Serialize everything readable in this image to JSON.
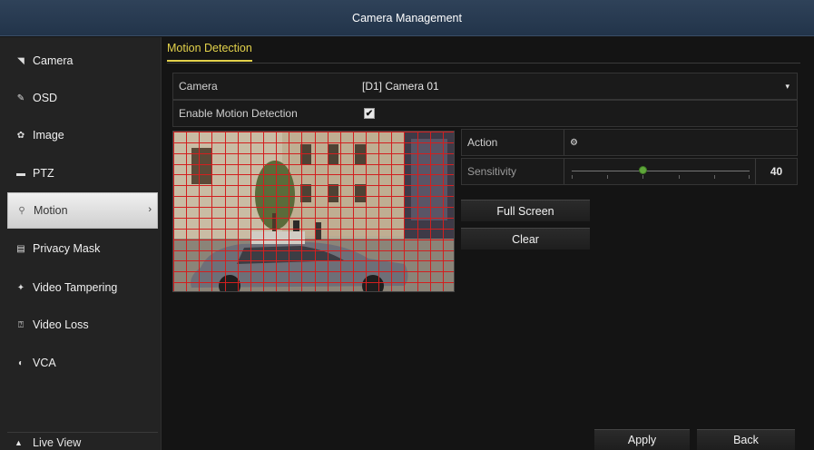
{
  "window": {
    "title": "Camera Management"
  },
  "sidebar": {
    "items": [
      {
        "label": "Camera",
        "icon": "camera-icon",
        "glyph": "◥"
      },
      {
        "label": "OSD",
        "icon": "osd-icon",
        "glyph": "✎"
      },
      {
        "label": "Image",
        "icon": "image-icon",
        "glyph": "✿"
      },
      {
        "label": "PTZ",
        "icon": "ptz-icon",
        "glyph": "▬"
      },
      {
        "label": "Motion",
        "icon": "motion-icon",
        "glyph": "⚲"
      },
      {
        "label": "Privacy Mask",
        "icon": "privacy-mask-icon",
        "glyph": "▤"
      },
      {
        "label": "Video Tampering",
        "icon": "video-tampering-icon",
        "glyph": "✦"
      },
      {
        "label": "Video Loss",
        "icon": "video-loss-icon",
        "glyph": "⍰"
      },
      {
        "label": "VCA",
        "icon": "vca-icon",
        "glyph": "◐"
      }
    ],
    "active": "Motion",
    "chevron": "›",
    "live_view": {
      "label": "Live View",
      "glyph": "▲"
    }
  },
  "main": {
    "tab": "Motion Detection",
    "camera_field": {
      "label": "Camera",
      "value": "[D1] Camera 01",
      "dropdown_glyph": "▾"
    },
    "enable_field": {
      "label": "Enable Motion Detection",
      "checked": true,
      "check_glyph": "✔"
    },
    "action": {
      "label": "Action",
      "glyph": "⚙"
    },
    "sensitivity": {
      "label": "Sensitivity",
      "value": "40",
      "level": 0.4
    },
    "buttons": {
      "full_screen": "Full Screen",
      "clear": "Clear"
    }
  },
  "footer": {
    "apply": "Apply",
    "back": "Back"
  },
  "colors": {
    "accent": "#e3d24b",
    "title_bar": "#2a3d55",
    "grid": "#d21f1f",
    "slider_knob": "#5fa73a"
  }
}
